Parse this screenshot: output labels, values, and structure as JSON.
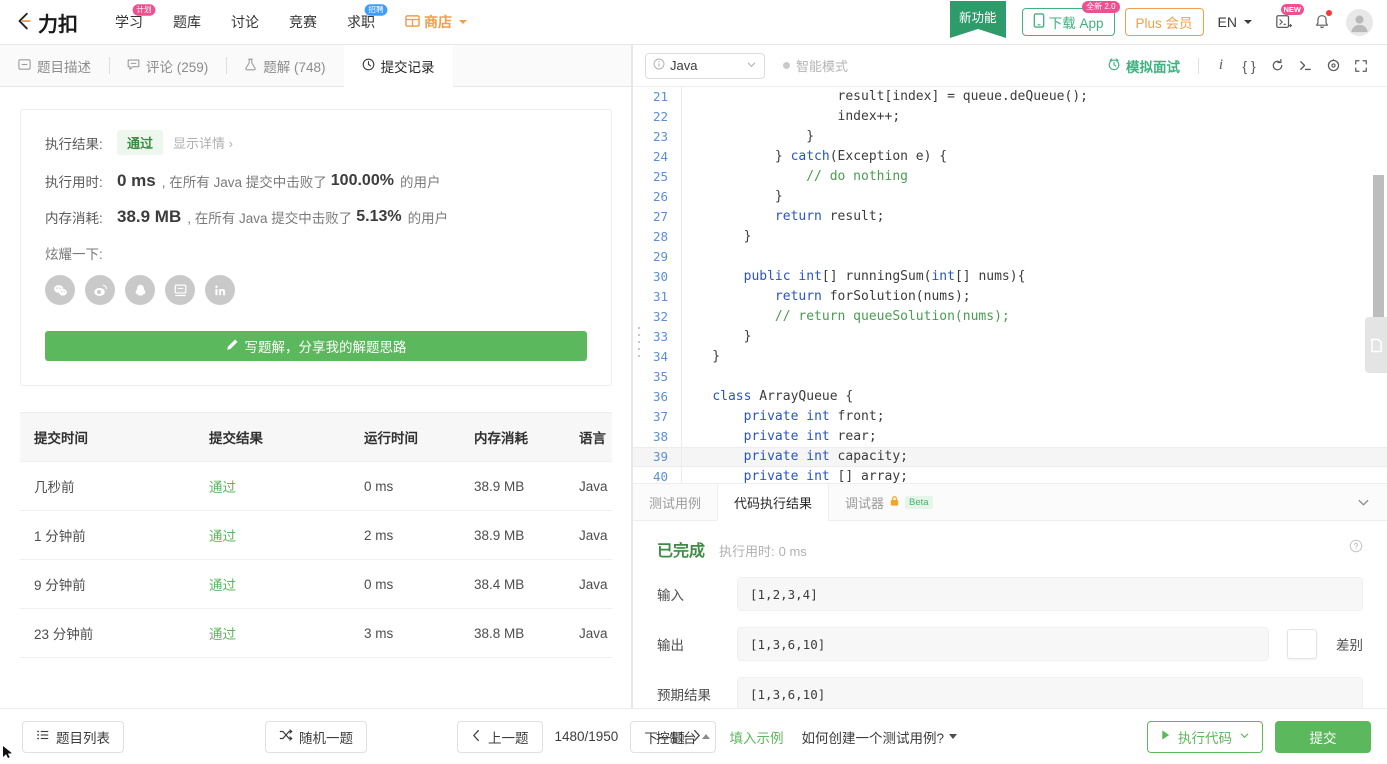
{
  "header": {
    "logo_text": "力扣",
    "nav": [
      {
        "label": "学习",
        "badge": "计划",
        "badge_color": "pink"
      },
      {
        "label": "题库",
        "badge": "",
        "badge_color": ""
      },
      {
        "label": "讨论",
        "badge": "",
        "badge_color": ""
      },
      {
        "label": "竞赛",
        "badge": "",
        "badge_color": ""
      },
      {
        "label": "求职",
        "badge": "招聘",
        "badge_color": "blue"
      },
      {
        "label": "商店",
        "badge": "",
        "badge_color": ""
      }
    ],
    "ribbon_label": "新功能",
    "download_app_label": "下载 App",
    "download_app_badge": "全新 2.0",
    "plus_label": "Plus 会员",
    "language_label": "EN",
    "code_icon_badge": "NEW",
    "accent_green": "#5cb85c",
    "accent_orange": "#f0a04b"
  },
  "left": {
    "tabs": [
      {
        "label": "题目描述",
        "icon": "description-icon",
        "active": false
      },
      {
        "label": "评论 (259)",
        "icon": "comment-icon",
        "active": false
      },
      {
        "label": "题解 (748)",
        "icon": "flask-icon",
        "active": false
      },
      {
        "label": "提交记录",
        "icon": "clock-icon",
        "active": true
      }
    ],
    "result": {
      "result_label": "执行结果:",
      "status": "通过",
      "detail_link": "显示详情 ›",
      "runtime_label": "执行用时:",
      "runtime_value": "0 ms",
      "runtime_suffix_pre": ", 在所有 Java 提交中击败了",
      "runtime_percent": "100.00%",
      "runtime_suffix_post": "的用户",
      "memory_label": "内存消耗:",
      "memory_value": "38.9 MB",
      "memory_suffix_pre": ", 在所有 Java 提交中击败了",
      "memory_percent": "5.13%",
      "memory_suffix_post": "的用户",
      "share_label": "炫耀一下:",
      "share_icons": [
        "wechat-icon",
        "weibo-icon",
        "qq-icon",
        "douban-icon",
        "linkedin-icon"
      ],
      "write_solution_btn": "写题解，分享我的解题思路"
    },
    "table": {
      "columns": [
        "提交时间",
        "提交结果",
        "运行时间",
        "内存消耗",
        "语言"
      ],
      "rows": [
        {
          "time": "几秒前",
          "result": "通过",
          "runtime": "0 ms",
          "memory": "38.9 MB",
          "lang": "Java"
        },
        {
          "time": "1 分钟前",
          "result": "通过",
          "runtime": "2 ms",
          "memory": "38.9 MB",
          "lang": "Java"
        },
        {
          "time": "9 分钟前",
          "result": "通过",
          "runtime": "0 ms",
          "memory": "38.4 MB",
          "lang": "Java"
        },
        {
          "time": "23 分钟前",
          "result": "通过",
          "runtime": "3 ms",
          "memory": "38.8 MB",
          "lang": "Java"
        }
      ]
    }
  },
  "editor": {
    "language": "Java",
    "smart_mode": "智能模式",
    "mock_interview": "模拟面试",
    "toolbar_icons": [
      "info-icon",
      "format-braces-icon",
      "reset-icon",
      "terminal-icon",
      "settings-icon",
      "fullscreen-icon"
    ],
    "lines": [
      {
        "n": "21",
        "code": "                    result[index] = queue.deQueue();"
      },
      {
        "n": "22",
        "code": "                    index++;"
      },
      {
        "n": "23",
        "code": "                }"
      },
      {
        "n": "24",
        "code": "            } catch(Exception e) {"
      },
      {
        "n": "25",
        "code": "                // do nothing"
      },
      {
        "n": "26",
        "code": "            }"
      },
      {
        "n": "27",
        "code": "            return result;"
      },
      {
        "n": "28",
        "code": "        }"
      },
      {
        "n": "29",
        "code": ""
      },
      {
        "n": "30",
        "code": "        public int[] runningSum(int[] nums){"
      },
      {
        "n": "31",
        "code": "            return forSolution(nums);"
      },
      {
        "n": "32",
        "code": "            // return queueSolution(nums);"
      },
      {
        "n": "33",
        "code": "        }"
      },
      {
        "n": "34",
        "code": "    }"
      },
      {
        "n": "35",
        "code": ""
      },
      {
        "n": "36",
        "code": "    class ArrayQueue {"
      },
      {
        "n": "37",
        "code": "        private int front;"
      },
      {
        "n": "38",
        "code": "        private int rear;"
      },
      {
        "n": "39",
        "code": "        private int capacity;"
      },
      {
        "n": "40",
        "code": "        private int [] array;"
      }
    ]
  },
  "console": {
    "tabs": [
      {
        "label": "测试用例",
        "active": false
      },
      {
        "label": "代码执行结果",
        "active": true
      },
      {
        "label": "调试器",
        "active": false,
        "lock": true,
        "beta": "Beta"
      }
    ],
    "status": "已完成",
    "runtime_label": "执行用时:",
    "runtime_value": "0 ms",
    "input_label": "输入",
    "input_value": "[1,2,3,4]",
    "output_label": "输出",
    "output_value": "[1,3,6,10]",
    "diff_label": "差别",
    "expected_label": "预期结果",
    "expected_value": "[1,3,6,10]"
  },
  "bottom": {
    "problem_list": "题目列表",
    "random_problem": "随机一题",
    "prev_problem": "上一题",
    "page_counter": "1480/1950",
    "next_problem": "下一题",
    "console_label": "控制台",
    "fill_example": "填入示例",
    "how_to": "如何创建一个测试用例?",
    "run_code": "执行代码",
    "submit": "提交"
  }
}
